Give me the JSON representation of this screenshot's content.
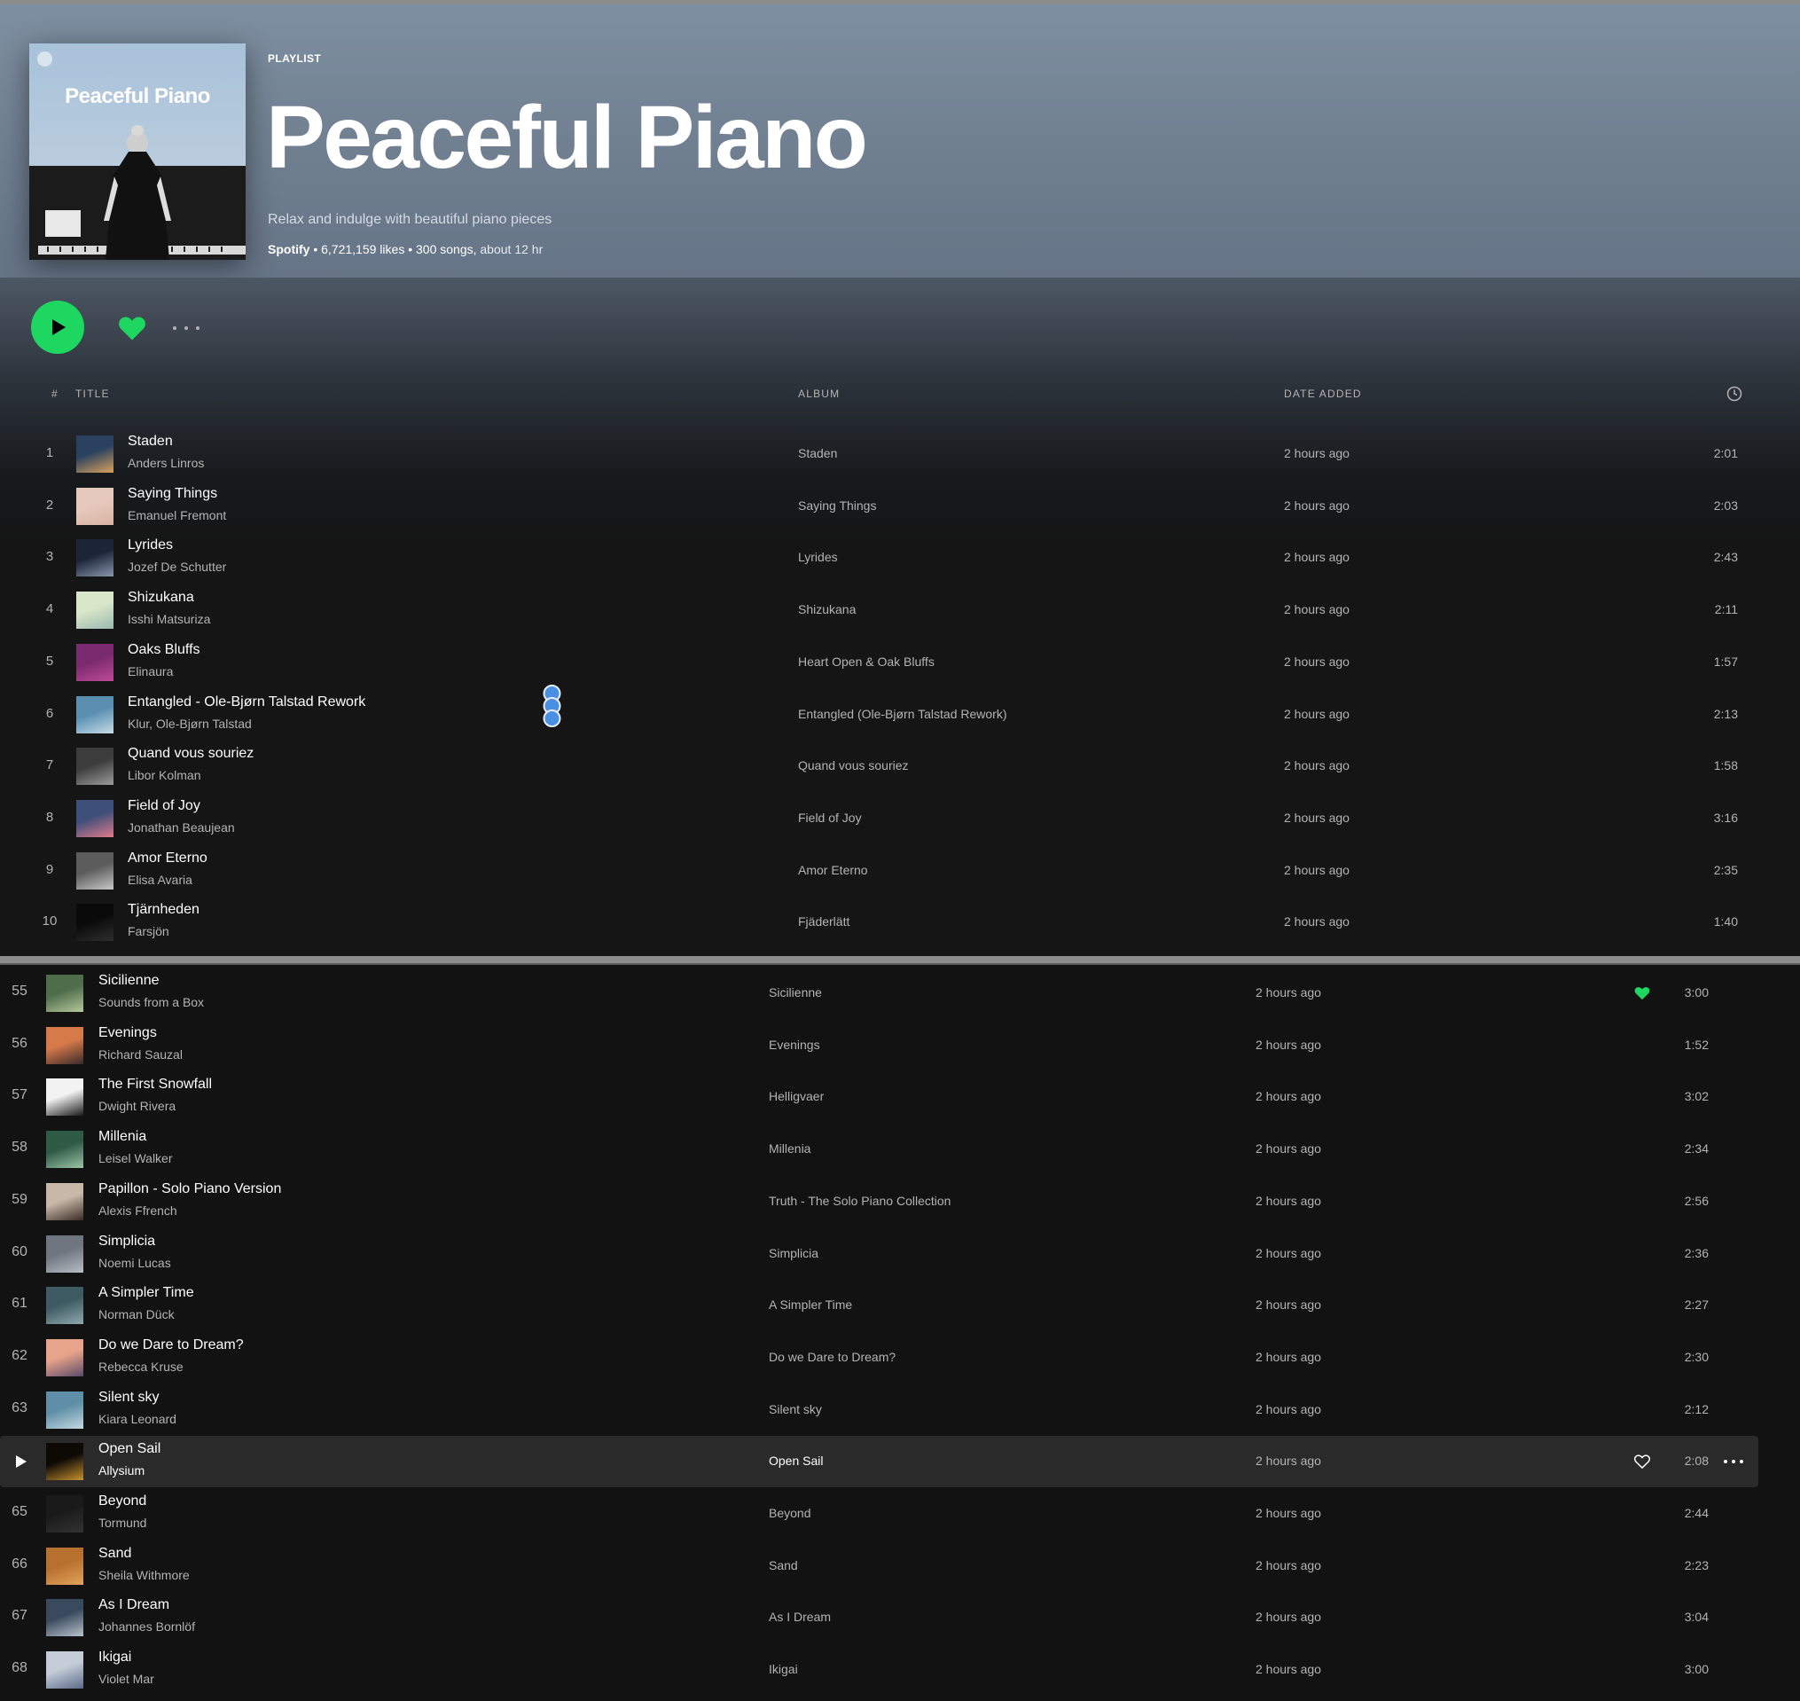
{
  "playlist": {
    "type_label": "PLAYLIST",
    "title": "Peaceful Piano",
    "cover_title": "Peaceful Piano",
    "description": "Relax and indulge with beautiful piano pieces",
    "owner": "Spotify",
    "likes": " • 6,721,159 likes",
    "songs": " • 300 songs, ",
    "duration": "about 12 hr"
  },
  "table_header": {
    "num": "#",
    "title": "TITLE",
    "album": "ALBUM",
    "date_added": "DATE ADDED",
    "duration_icon": "clock-icon"
  },
  "colors": {
    "accent_green": "#1ed760",
    "header_gradient_top": "#7e8fa1",
    "background": "#121212",
    "row_hover": "#2a2a2a"
  },
  "tracks_top": [
    {
      "num": "1",
      "title": "Staden",
      "artist": "Anders Linros",
      "album": "Staden",
      "date": "2 hours ago",
      "duration": "2:01"
    },
    {
      "num": "2",
      "title": "Saying Things",
      "artist": "Emanuel Fremont",
      "album": "Saying Things",
      "date": "2 hours ago",
      "duration": "2:03"
    },
    {
      "num": "3",
      "title": "Lyrides",
      "artist": "Jozef De Schutter",
      "album": "Lyrides",
      "date": "2 hours ago",
      "duration": "2:43"
    },
    {
      "num": "4",
      "title": "Shizukana",
      "artist": "Isshi Matsuriza",
      "album": "Shizukana",
      "date": "2 hours ago",
      "duration": "2:11"
    },
    {
      "num": "5",
      "title": "Oaks Bluffs",
      "artist": "Elinaura",
      "album": "Heart Open & Oak Bluffs",
      "date": "2 hours ago",
      "duration": "1:57"
    },
    {
      "num": "6",
      "title": "Entangled - Ole-Bjørn Talstad Rework",
      "artist": "Klur, Ole-Bjørn Talstad",
      "album": "Entangled (Ole-Bjørn Talstad Rework)",
      "date": "2 hours ago",
      "duration": "2:13"
    },
    {
      "num": "7",
      "title": "Quand vous souriez",
      "artist": "Libor Kolman",
      "album": "Quand vous souriez",
      "date": "2 hours ago",
      "duration": "1:58"
    },
    {
      "num": "8",
      "title": "Field of Joy",
      "artist": "Jonathan Beaujean",
      "album": "Field of Joy",
      "date": "2 hours ago",
      "duration": "3:16"
    },
    {
      "num": "9",
      "title": "Amor Eterno",
      "artist": "Elisa Avaria",
      "album": "Amor Eterno",
      "date": "2 hours ago",
      "duration": "2:35"
    },
    {
      "num": "10",
      "title": "Tjärnheden",
      "artist": "Farsjön",
      "album": "Fjäderlätt",
      "date": "2 hours ago",
      "duration": "1:40"
    }
  ],
  "tracks_bottom": [
    {
      "num": "55",
      "title": "Sicilienne",
      "artist": "Sounds from a Box",
      "album": "Sicilienne",
      "date": "2 hours ago",
      "duration": "3:00",
      "liked": true
    },
    {
      "num": "56",
      "title": "Evenings",
      "artist": "Richard Sauzal",
      "album": "Evenings",
      "date": "2 hours ago",
      "duration": "1:52"
    },
    {
      "num": "57",
      "title": "The First Snowfall",
      "artist": "Dwight Rivera",
      "album": "Helligvaer",
      "date": "2 hours ago",
      "duration": "3:02"
    },
    {
      "num": "58",
      "title": "Millenia",
      "artist": "Leisel Walker",
      "album": "Millenia",
      "date": "2 hours ago",
      "duration": "2:34"
    },
    {
      "num": "59",
      "title": "Papillon - Solo Piano Version",
      "artist": "Alexis Ffrench",
      "album": "Truth - The Solo Piano Collection",
      "date": "2 hours ago",
      "duration": "2:56"
    },
    {
      "num": "60",
      "title": "Simplicia",
      "artist": "Noemi Lucas",
      "album": "Simplicia",
      "date": "2 hours ago",
      "duration": "2:36"
    },
    {
      "num": "61",
      "title": "A Simpler Time",
      "artist": "Norman Dück",
      "album": "A Simpler Time",
      "date": "2 hours ago",
      "duration": "2:27"
    },
    {
      "num": "62",
      "title": "Do we Dare to Dream?",
      "artist": "Rebecca Kruse",
      "album": "Do we Dare to Dream?",
      "date": "2 hours ago",
      "duration": "2:30"
    },
    {
      "num": "63",
      "title": "Silent sky",
      "artist": "Kiara Leonard",
      "album": "Silent sky",
      "date": "2 hours ago",
      "duration": "2:12"
    },
    {
      "num": "64",
      "title": "Open Sail",
      "artist": "Allysium",
      "album": "Open Sail",
      "date": "2 hours ago",
      "duration": "2:08",
      "hover": true
    },
    {
      "num": "65",
      "title": "Beyond",
      "artist": "Tormund",
      "album": "Beyond",
      "date": "2 hours ago",
      "duration": "2:44"
    },
    {
      "num": "66",
      "title": "Sand",
      "artist": "Sheila Withmore",
      "album": "Sand",
      "date": "2 hours ago",
      "duration": "2:23"
    },
    {
      "num": "67",
      "title": "As I Dream",
      "artist": "Johannes Bornlöf",
      "album": "As I Dream",
      "date": "2 hours ago",
      "duration": "3:04"
    },
    {
      "num": "68",
      "title": "Ikigai",
      "artist": "Violet Mar",
      "album": "Ikigai",
      "date": "2 hours ago",
      "duration": "3:00"
    }
  ]
}
